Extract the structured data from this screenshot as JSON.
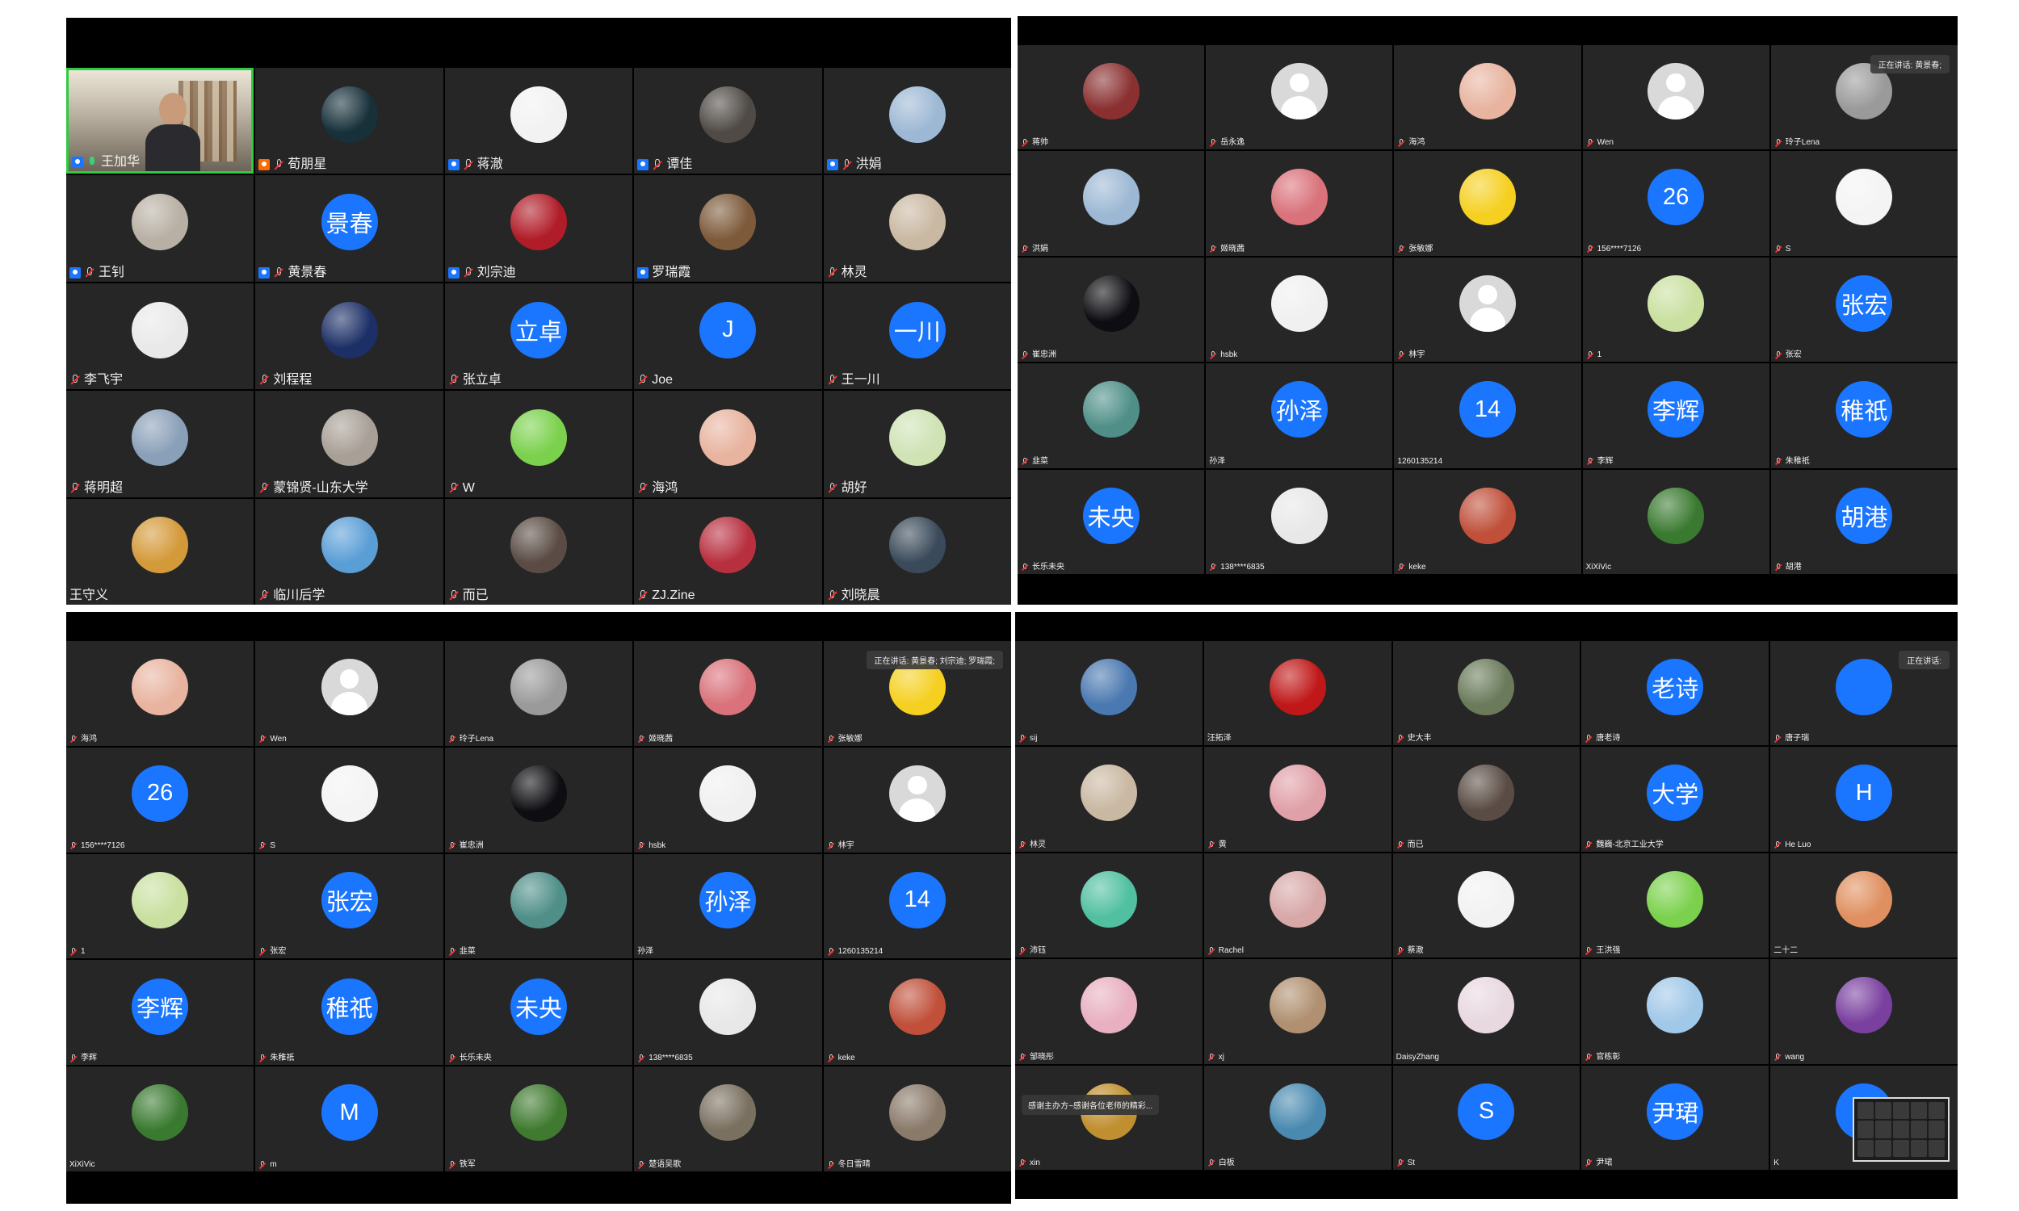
{
  "colors": {
    "screen_bg": "#000000",
    "tile_bg": "#262626",
    "avatar_blue": "#1a75ff",
    "active_speaker_border": "#2ecc40"
  },
  "panels": [
    {
      "tiles": [
        {
          "name": "王加华",
          "avatar": "video",
          "host": "blue",
          "mic": "on"
        },
        {
          "name": "荀朋星",
          "avatar": "photo",
          "color": "#17303a",
          "host": "orange",
          "mic": "off"
        },
        {
          "name": "蒋澈",
          "avatar": "photo",
          "color": "#f2f2f2",
          "host": "blue",
          "mic": "off"
        },
        {
          "name": "谭佳",
          "avatar": "photo",
          "color": "#4f4a45",
          "host": "blue",
          "mic": "off"
        },
        {
          "name": "洪娟",
          "avatar": "photo",
          "color": "#9db8d4",
          "host": "blue",
          "mic": "off"
        },
        {
          "name": "王钊",
          "avatar": "photo",
          "color": "#b8b0a4",
          "host": "blue",
          "mic": "off"
        },
        {
          "name": "黄景春",
          "avatar": "text",
          "initials": "景春",
          "host": "blue",
          "mic": "off"
        },
        {
          "name": "刘宗迪",
          "avatar": "photo",
          "color": "#b01c28",
          "host": "blue",
          "mic": "off"
        },
        {
          "name": "罗瑞霞",
          "avatar": "photo",
          "color": "#7d5a3a",
          "host": "blue",
          "mic": "none"
        },
        {
          "name": "林灵",
          "avatar": "photo",
          "color": "#c9b8a2",
          "mic": "off"
        },
        {
          "name": "李飞宇",
          "avatar": "photo",
          "color": "#e9e9e9",
          "mic": "off"
        },
        {
          "name": "刘程程",
          "avatar": "photo",
          "color": "#1c2f66",
          "mic": "off"
        },
        {
          "name": "张立卓",
          "avatar": "text",
          "initials": "立卓",
          "mic": "off"
        },
        {
          "name": "Joe",
          "avatar": "text",
          "initials": "J",
          "mic": "off"
        },
        {
          "name": "王一川",
          "avatar": "text",
          "initials": "一川",
          "mic": "off"
        },
        {
          "name": "蒋明超",
          "avatar": "photo",
          "color": "#8aa0b8",
          "mic": "off"
        },
        {
          "name": "蒙锦贤-山东大学",
          "avatar": "photo",
          "color": "#a89f96",
          "mic": "off"
        },
        {
          "name": "W",
          "avatar": "photo",
          "color": "#7bd14d",
          "mic": "off"
        },
        {
          "name": "海鸿",
          "avatar": "photo",
          "color": "#e8b4a0",
          "mic": "off"
        },
        {
          "name": "胡好",
          "avatar": "photo",
          "color": "#cfe3b5",
          "mic": "off"
        },
        {
          "name": "王守义",
          "avatar": "photo",
          "color": "#d49a3a",
          "mic": "none"
        },
        {
          "name": "临川后学",
          "avatar": "photo",
          "color": "#5a9ed6",
          "mic": "off"
        },
        {
          "name": "而已",
          "avatar": "photo",
          "color": "#5a4c44",
          "mic": "off"
        },
        {
          "name": "ZJ.Zine",
          "avatar": "photo",
          "color": "#b83040",
          "mic": "off"
        },
        {
          "name": "刘晓晨",
          "avatar": "photo",
          "color": "#3a4a5a",
          "mic": "off"
        }
      ]
    },
    {
      "speaker_bubble": "正在讲话: 黄景春;",
      "tiles": [
        {
          "name": "蒋帅",
          "avatar": "photo",
          "color": "#8a3030",
          "mic": "off"
        },
        {
          "name": "岳永逸",
          "avatar": "default",
          "mic": "off"
        },
        {
          "name": "海鸿",
          "avatar": "photo",
          "color": "#e8b4a0",
          "mic": "off"
        },
        {
          "name": "Wen",
          "avatar": "default",
          "mic": "off"
        },
        {
          "name": "玲子Lena",
          "avatar": "photo",
          "color": "#9a9a9a",
          "mic": "off"
        },
        {
          "name": "洪娟",
          "avatar": "photo",
          "color": "#9db8d4",
          "mic": "off"
        },
        {
          "name": "姬晓茜",
          "avatar": "photo",
          "color": "#d9727a",
          "mic": "off"
        },
        {
          "name": "张敏娜",
          "avatar": "photo",
          "color": "#f5d020",
          "mic": "off"
        },
        {
          "name": "156****7126",
          "avatar": "text",
          "initials": "26",
          "mic": "off"
        },
        {
          "name": "S",
          "avatar": "photo",
          "color": "#f4f4f4",
          "mic": "off"
        },
        {
          "name": "崔忠洲",
          "avatar": "photo",
          "color": "#0e0e12",
          "mic": "off"
        },
        {
          "name": "hsbk",
          "avatar": "photo",
          "color": "#f0f0f0",
          "mic": "off"
        },
        {
          "name": "林宇",
          "avatar": "default",
          "mic": "off"
        },
        {
          "name": "1",
          "avatar": "photo",
          "color": "#c9e0a0",
          "mic": "off"
        },
        {
          "name": "张宏",
          "avatar": "text",
          "initials": "张宏",
          "mic": "off"
        },
        {
          "name": "韭菜",
          "avatar": "photo",
          "color": "#4f8f88",
          "mic": "off"
        },
        {
          "name": "孙泽",
          "avatar": "text",
          "initials": "孙泽",
          "mic": "none"
        },
        {
          "name": "1260135214",
          "avatar": "text",
          "initials": "14",
          "mic": "none"
        },
        {
          "name": "李辉",
          "avatar": "text",
          "initials": "李辉",
          "mic": "off"
        },
        {
          "name": "朱稚祇",
          "avatar": "text",
          "initials": "稚祇",
          "mic": "off"
        },
        {
          "name": "长乐未央",
          "avatar": "text",
          "initials": "未央",
          "mic": "off"
        },
        {
          "name": "138****6835",
          "avatar": "photo",
          "color": "#e8e8e8",
          "mic": "off"
        },
        {
          "name": "keke",
          "avatar": "photo",
          "color": "#c0503a",
          "mic": "off"
        },
        {
          "name": "XiXiVic",
          "avatar": "photo",
          "color": "#3a7a30",
          "mic": "none"
        },
        {
          "name": "胡港",
          "avatar": "text",
          "initials": "胡港",
          "mic": "off"
        }
      ]
    },
    {
      "speaker_bubble": "正在讲话: 黄景春; 刘宗迪; 罗瑞霞;",
      "tiles": [
        {
          "name": "海鸿",
          "avatar": "photo",
          "color": "#e8b4a0",
          "mic": "off"
        },
        {
          "name": "Wen",
          "avatar": "default",
          "mic": "off"
        },
        {
          "name": "玲子Lena",
          "avatar": "photo",
          "color": "#9a9a9a",
          "mic": "off"
        },
        {
          "name": "姬晓茜",
          "avatar": "photo",
          "color": "#d9727a",
          "mic": "off"
        },
        {
          "name": "张敏娜",
          "avatar": "photo",
          "color": "#f5d020",
          "mic": "off"
        },
        {
          "name": "156****7126",
          "avatar": "text",
          "initials": "26",
          "mic": "off"
        },
        {
          "name": "S",
          "avatar": "photo",
          "color": "#f4f4f4",
          "mic": "off"
        },
        {
          "name": "崔忠洲",
          "avatar": "photo",
          "color": "#0e0e12",
          "mic": "off"
        },
        {
          "name": "hsbk",
          "avatar": "photo",
          "color": "#f0f0f0",
          "mic": "off"
        },
        {
          "name": "林宇",
          "avatar": "default",
          "mic": "off"
        },
        {
          "name": "1",
          "avatar": "photo",
          "color": "#c9e0a0",
          "mic": "off"
        },
        {
          "name": "张宏",
          "avatar": "text",
          "initials": "张宏",
          "mic": "off"
        },
        {
          "name": "韭菜",
          "avatar": "photo",
          "color": "#4f8f88",
          "mic": "off"
        },
        {
          "name": "孙泽",
          "avatar": "text",
          "initials": "孙泽",
          "mic": "none"
        },
        {
          "name": "1260135214",
          "avatar": "text",
          "initials": "14",
          "mic": "off"
        },
        {
          "name": "李辉",
          "avatar": "text",
          "initials": "李辉",
          "mic": "off"
        },
        {
          "name": "朱稚祇",
          "avatar": "text",
          "initials": "稚祇",
          "mic": "off"
        },
        {
          "name": "长乐未央",
          "avatar": "text",
          "initials": "未央",
          "mic": "off"
        },
        {
          "name": "138****6835",
          "avatar": "photo",
          "color": "#e8e8e8",
          "mic": "off"
        },
        {
          "name": "keke",
          "avatar": "photo",
          "color": "#c0503a",
          "mic": "off"
        },
        {
          "name": "XiXiVic",
          "avatar": "photo",
          "color": "#3a7a30",
          "mic": "none"
        },
        {
          "name": "m",
          "avatar": "text",
          "initials": "M",
          "mic": "off"
        },
        {
          "name": "铁军",
          "avatar": "photo",
          "color": "#3f7a30",
          "mic": "off"
        },
        {
          "name": "楚语吴歌",
          "avatar": "photo",
          "color": "#7a7060",
          "mic": "off"
        },
        {
          "name": "冬日雪晴",
          "avatar": "photo",
          "color": "#8a7a6a",
          "mic": "off"
        }
      ]
    },
    {
      "speaker_bubble": "正在讲话:",
      "chat_message": "感谢主办方~感谢各位老师的精彩...",
      "tiles": [
        {
          "name": "sij",
          "avatar": "photo",
          "color": "#4a78b0",
          "mic": "off"
        },
        {
          "name": "汪拓泽",
          "avatar": "photo",
          "color": "#c01818",
          "mic": "none"
        },
        {
          "name": "史大丰",
          "avatar": "photo",
          "color": "#6a7a5a",
          "mic": "off"
        },
        {
          "name": "唐老诗",
          "avatar": "text",
          "initials": "老诗",
          "mic": "off"
        },
        {
          "name": "唐子瑞",
          "avatar": "text",
          "initials": "",
          "mic": "off"
        },
        {
          "name": "林灵",
          "avatar": "photo",
          "color": "#c9b8a2",
          "mic": "off"
        },
        {
          "name": "黄",
          "avatar": "photo",
          "color": "#e0a0a8",
          "mic": "off"
        },
        {
          "name": "而已",
          "avatar": "photo",
          "color": "#5a4c44",
          "mic": "off"
        },
        {
          "name": "魏巍-北京工业大学",
          "avatar": "text",
          "initials": "大学",
          "mic": "off"
        },
        {
          "name": "He Luo",
          "avatar": "text",
          "initials": "H",
          "mic": "off"
        },
        {
          "name": "沛钰",
          "avatar": "photo",
          "color": "#50c0a0",
          "mic": "off"
        },
        {
          "name": "Rachel",
          "avatar": "photo",
          "color": "#d8a8a8",
          "mic": "off"
        },
        {
          "name": "蔡澈",
          "avatar": "photo",
          "color": "#f2f2f2",
          "mic": "off"
        },
        {
          "name": "王洪强",
          "avatar": "photo",
          "color": "#7bd14d",
          "mic": "off"
        },
        {
          "name": "二十二",
          "avatar": "photo",
          "color": "#e09060",
          "mic": "none"
        },
        {
          "name": "邹晓彤",
          "avatar": "photo",
          "color": "#e8b0c0",
          "mic": "off"
        },
        {
          "name": "xj",
          "avatar": "photo",
          "color": "#b09070",
          "mic": "off"
        },
        {
          "name": "DaisyZhang",
          "avatar": "photo",
          "color": "#e8d8e0",
          "mic": "none"
        },
        {
          "name": "官栋彰",
          "avatar": "photo",
          "color": "#a0c8e8",
          "mic": "off"
        },
        {
          "name": "wang",
          "avatar": "photo",
          "color": "#7a40a0",
          "mic": "off"
        },
        {
          "name": "xin",
          "avatar": "photo",
          "color": "#c09030",
          "mic": "off"
        },
        {
          "name": "白板",
          "avatar": "photo",
          "color": "#4a8ab0",
          "mic": "off"
        },
        {
          "name": "St",
          "avatar": "text",
          "initials": "S",
          "mic": "off"
        },
        {
          "name": "尹珺",
          "avatar": "text",
          "initials": "尹珺",
          "mic": "off"
        },
        {
          "name": "K",
          "avatar": "text",
          "initials": "",
          "mic": "none"
        }
      ]
    }
  ]
}
